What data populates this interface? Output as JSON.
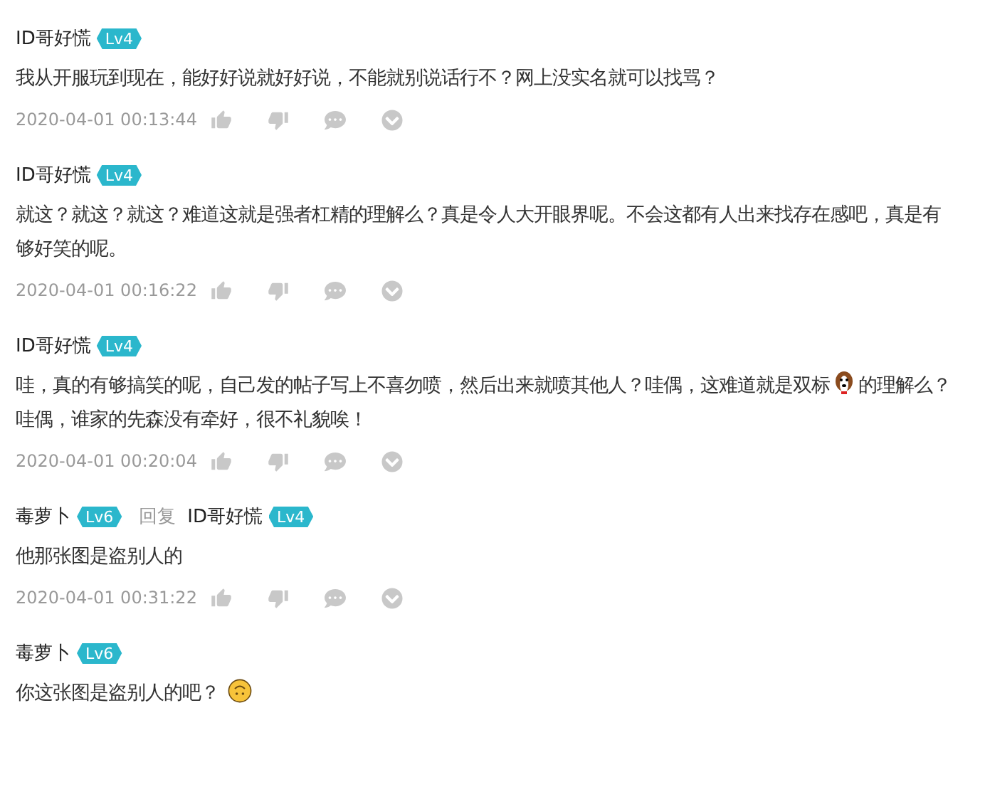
{
  "comments": [
    {
      "author": "ID哥好慌",
      "level": "Lv4",
      "body": [
        {
          "kind": "text",
          "text": "我从开服玩到现在，能好好说就好好说，不能就别说话行不？网上没实名就可以找骂？"
        }
      ],
      "time": "2020-04-01 00:13:44"
    },
    {
      "author": "ID哥好慌",
      "level": "Lv4",
      "body": [
        {
          "kind": "text",
          "text": "就这？就这？就这？难道这就是强者杠精的理解么？真是令人大开眼界呢。不会这都有人出来找存在感吧，真是有够好笑的呢。"
        }
      ],
      "time": "2020-04-01 00:16:22"
    },
    {
      "author": "ID哥好慌",
      "level": "Lv4",
      "body": [
        {
          "kind": "text",
          "text": "哇，真的有够搞笑的呢，自己发的帖子写上不喜勿喷，然后出来就喷其他人？哇偶，这难道就是双标"
        },
        {
          "kind": "dog"
        },
        {
          "kind": "text",
          "text": "的理解么？哇偶，谁家的先森没有牵好，很不礼貌唉！"
        }
      ],
      "time": "2020-04-01 00:20:04"
    },
    {
      "author": "毒萝卜",
      "level": "Lv6",
      "reply": {
        "label": "回复",
        "author": "ID哥好慌",
        "level": "Lv4"
      },
      "body": [
        {
          "kind": "text",
          "text": "他那张图是盗别人的"
        }
      ],
      "time": "2020-04-01 00:31:22"
    },
    {
      "author": "毒萝卜",
      "level": "Lv6",
      "body": [
        {
          "kind": "text",
          "text": "你这张图是盗别人的吧？"
        },
        {
          "kind": "upside-down"
        }
      ]
    }
  ]
}
